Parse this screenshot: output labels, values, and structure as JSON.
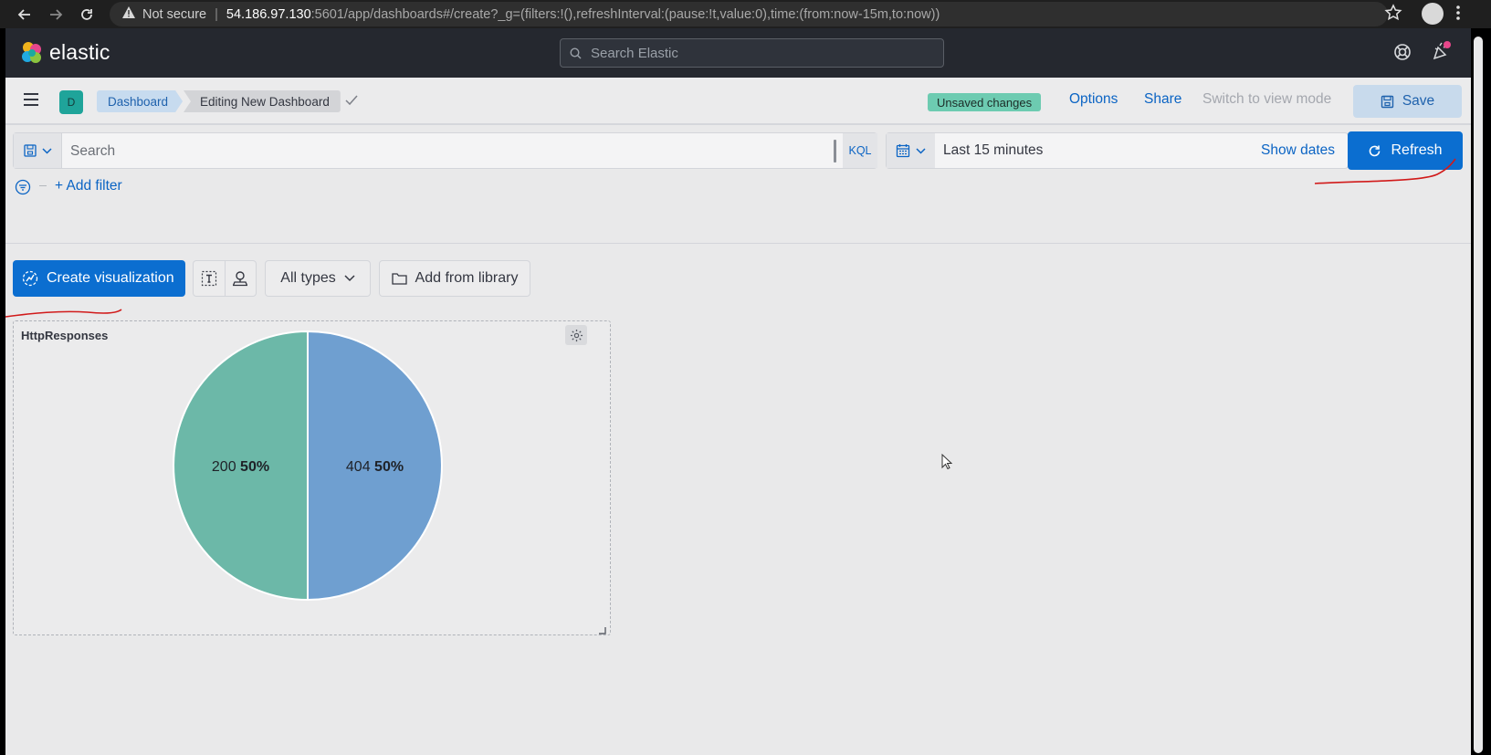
{
  "browser": {
    "security_label": "Not secure",
    "url_host": "54.186.97.130",
    "url_path": ":5601/app/dashboards#/create?_g=(filters:!(),refreshInterval:(pause:!t,value:0),time:(from:now-15m,to:now))"
  },
  "header": {
    "logo_text": "elastic",
    "search_placeholder": "Search Elastic"
  },
  "topnav": {
    "space_initial": "D",
    "breadcrumbs": [
      "Dashboard",
      "Editing New Dashboard"
    ],
    "unsaved_badge": "Unsaved changes",
    "options": "Options",
    "share": "Share",
    "switch_mode": "Switch to view mode",
    "save": "Save"
  },
  "query": {
    "placeholder": "Search",
    "language": "KQL",
    "time_range": "Last 15 minutes",
    "show_dates": "Show dates",
    "refresh": "Refresh",
    "add_filter": "+ Add filter"
  },
  "toolbar": {
    "create_visualization": "Create visualization",
    "all_types": "All types",
    "add_from_library": "Add from library"
  },
  "panel": {
    "title": "HttpResponses"
  },
  "chart_data": {
    "type": "pie",
    "title": "HttpResponses",
    "slices": [
      {
        "label": "404",
        "value": 50,
        "percent_label": "50%",
        "color": "#6f9fd0"
      },
      {
        "label": "200",
        "value": 50,
        "percent_label": "50%",
        "color": "#6cb8a8"
      }
    ]
  },
  "colors": {
    "accent": "#0b6ed0",
    "header_bg": "#25282f",
    "page_bg": "#e9e9ea",
    "annotation": "#d11a1a"
  }
}
